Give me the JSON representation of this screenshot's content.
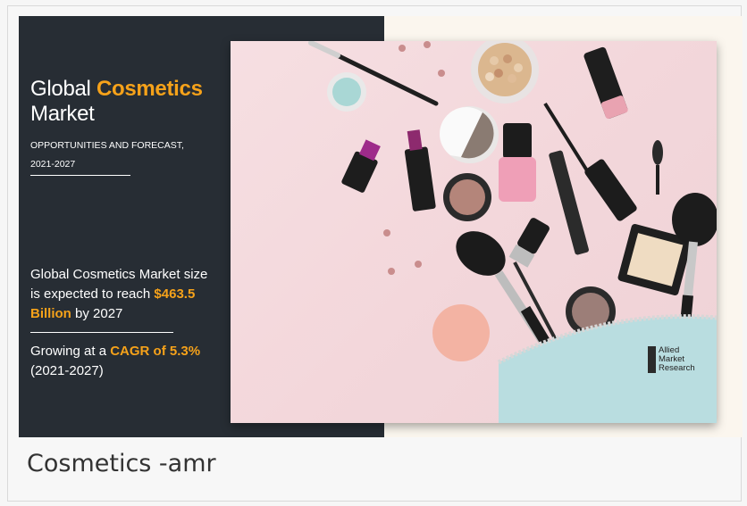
{
  "banner": {
    "title_prefix": "Global",
    "title_accent": "Cosmetics",
    "title_line2": "Market",
    "subtitle_line1": "OPPORTUNITIES AND FORECAST,",
    "subtitle_line2": "2021-2027",
    "stat1_text": "Global Cosmetics Market size is expected to reach",
    "stat1_value": "$463.5  Billion",
    "stat1_suffix": "by 2027",
    "stat2_prefix": "Growing at a",
    "stat2_value": "CAGR of 5.3%",
    "stat2_period": "(2021-2027)",
    "logo_line1": "Allied",
    "logo_line2": "Market",
    "logo_line3": "Research"
  },
  "caption": "Cosmetics -amr",
  "colors": {
    "panel": "#272d34",
    "accent": "#f6a21a",
    "photo_bg": "#f3d7db"
  }
}
